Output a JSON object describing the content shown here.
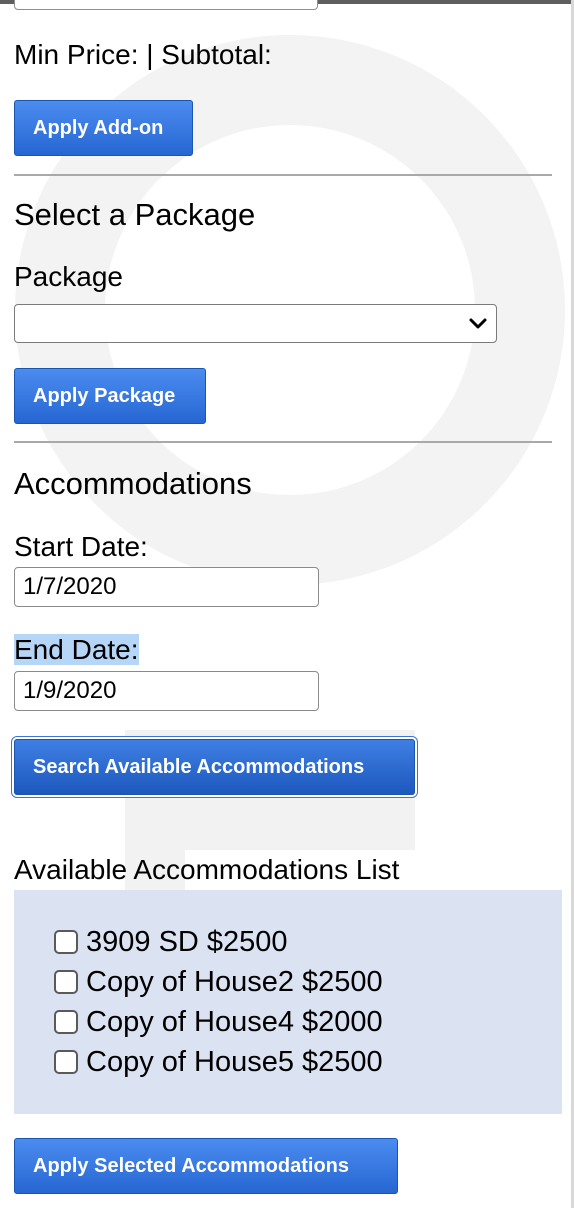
{
  "addon": {
    "price_line": "Min Price: | Subtotal:",
    "apply_button": "Apply Add-on"
  },
  "package": {
    "heading": "Select a Package",
    "label": "Package",
    "selected_value": "",
    "apply_button": "Apply Package"
  },
  "accommodations": {
    "heading": "Accommodations",
    "start_label": "Start Date:",
    "start_value": "1/7/2020",
    "end_label": "End Date:",
    "end_value": "1/9/2020",
    "search_button": "Search Available Accommodations",
    "list_heading": "Available Accommodations List",
    "items": [
      {
        "label": "3909 SD $2500",
        "checked": false
      },
      {
        "label": "Copy of House2 $2500",
        "checked": false
      },
      {
        "label": "Copy of House4 $2000",
        "checked": false
      },
      {
        "label": "Copy of House5 $2500",
        "checked": false
      }
    ],
    "apply_button": "Apply Selected Accommodations"
  },
  "colors": {
    "button": "#2f6fdc",
    "list_background": "#dbe3f2",
    "text_selection": "#b6d6f7"
  },
  "icons": {
    "select_arrow": "chevron-down-icon",
    "checkbox": "checkbox-icon"
  }
}
